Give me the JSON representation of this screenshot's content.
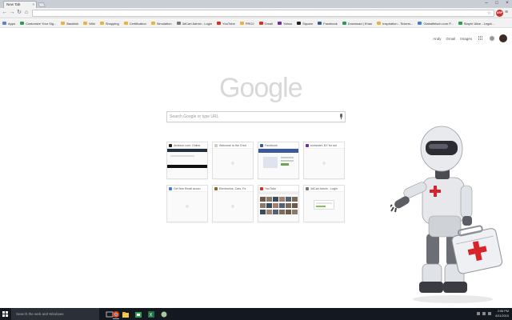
{
  "window": {
    "tab_title": "New Tab",
    "tab_close": "×",
    "min": "–",
    "max": "□",
    "close": "×"
  },
  "toolbar": {
    "back": "←",
    "forward": "→",
    "reload": "↻",
    "home": "⌂",
    "address_value": "",
    "star": "☆",
    "ext_badge": "ABP",
    "menu": "≡"
  },
  "bookmarks": [
    {
      "label": "Apps",
      "color": "#5f7fd6"
    },
    {
      "label": "Customize Your Sig...",
      "color": "#2e9d52"
    },
    {
      "label": "Backlink",
      "color": "#e8b53a"
    },
    {
      "label": "Wiki",
      "color": "#e8b53a"
    },
    {
      "label": "Shopping",
      "color": "#e8b53a"
    },
    {
      "label": "Certification",
      "color": "#e8b53a"
    },
    {
      "label": "Simulation",
      "color": "#e8b53a"
    },
    {
      "label": "3dCart Admin - Login",
      "color": "#777777"
    },
    {
      "label": "YouTube",
      "color": "#e02b20"
    },
    {
      "label": "PROJ",
      "color": "#e8b53a"
    },
    {
      "label": "Gmail",
      "color": "#d93025"
    },
    {
      "label": "Yahoo",
      "color": "#6b2ea8"
    },
    {
      "label": "Square",
      "color": "#222222"
    },
    {
      "label": "Facebook",
      "color": "#3b5998"
    },
    {
      "label": "Download | Khan",
      "color": "#2e9d52"
    },
    {
      "label": "Inspiration - Tinkers...",
      "color": "#e8b53a"
    },
    {
      "label": "Glabalfelsch.com P...",
      "color": "#3d7fd6"
    },
    {
      "label": "Stayin' Alive - Legal...",
      "color": "#2e9d52"
    }
  ],
  "top_links": {
    "user": "Andy",
    "gmail": "Gmail",
    "images": "Images"
  },
  "logo_text": "Google",
  "search": {
    "placeholder": "Search Google or type URL"
  },
  "tiles": [
    {
      "title": "Amazon.com: Online",
      "favicon_color": "#222222",
      "thumb": "amazon"
    },
    {
      "title": "Welcome to the Cred",
      "favicon_color": "#cccccc",
      "thumb": "blank"
    },
    {
      "title": "Facebook",
      "favicon_color": "#3b5998",
      "thumb": "facebook"
    },
    {
      "title": "rochester, NY for sal",
      "favicon_color": "#6b2ea8",
      "thumb": "blank"
    },
    {
      "title": "Get free Email accou",
      "favicon_color": "#3d7fd6",
      "thumb": "blank"
    },
    {
      "title": "Electronics, Cars, Fa",
      "favicon_color": "#8a6a2a",
      "thumb": "blank"
    },
    {
      "title": "YouTube",
      "favicon_color": "#e02b20",
      "thumb": "youtube"
    },
    {
      "title": "3dCart Admin - Login",
      "favicon_color": "#777777",
      "thumb": "login"
    }
  ],
  "taskbar": {
    "search_placeholder": "Search the web and Windows",
    "time": "2:56 PM",
    "date": "8/11/2015"
  }
}
